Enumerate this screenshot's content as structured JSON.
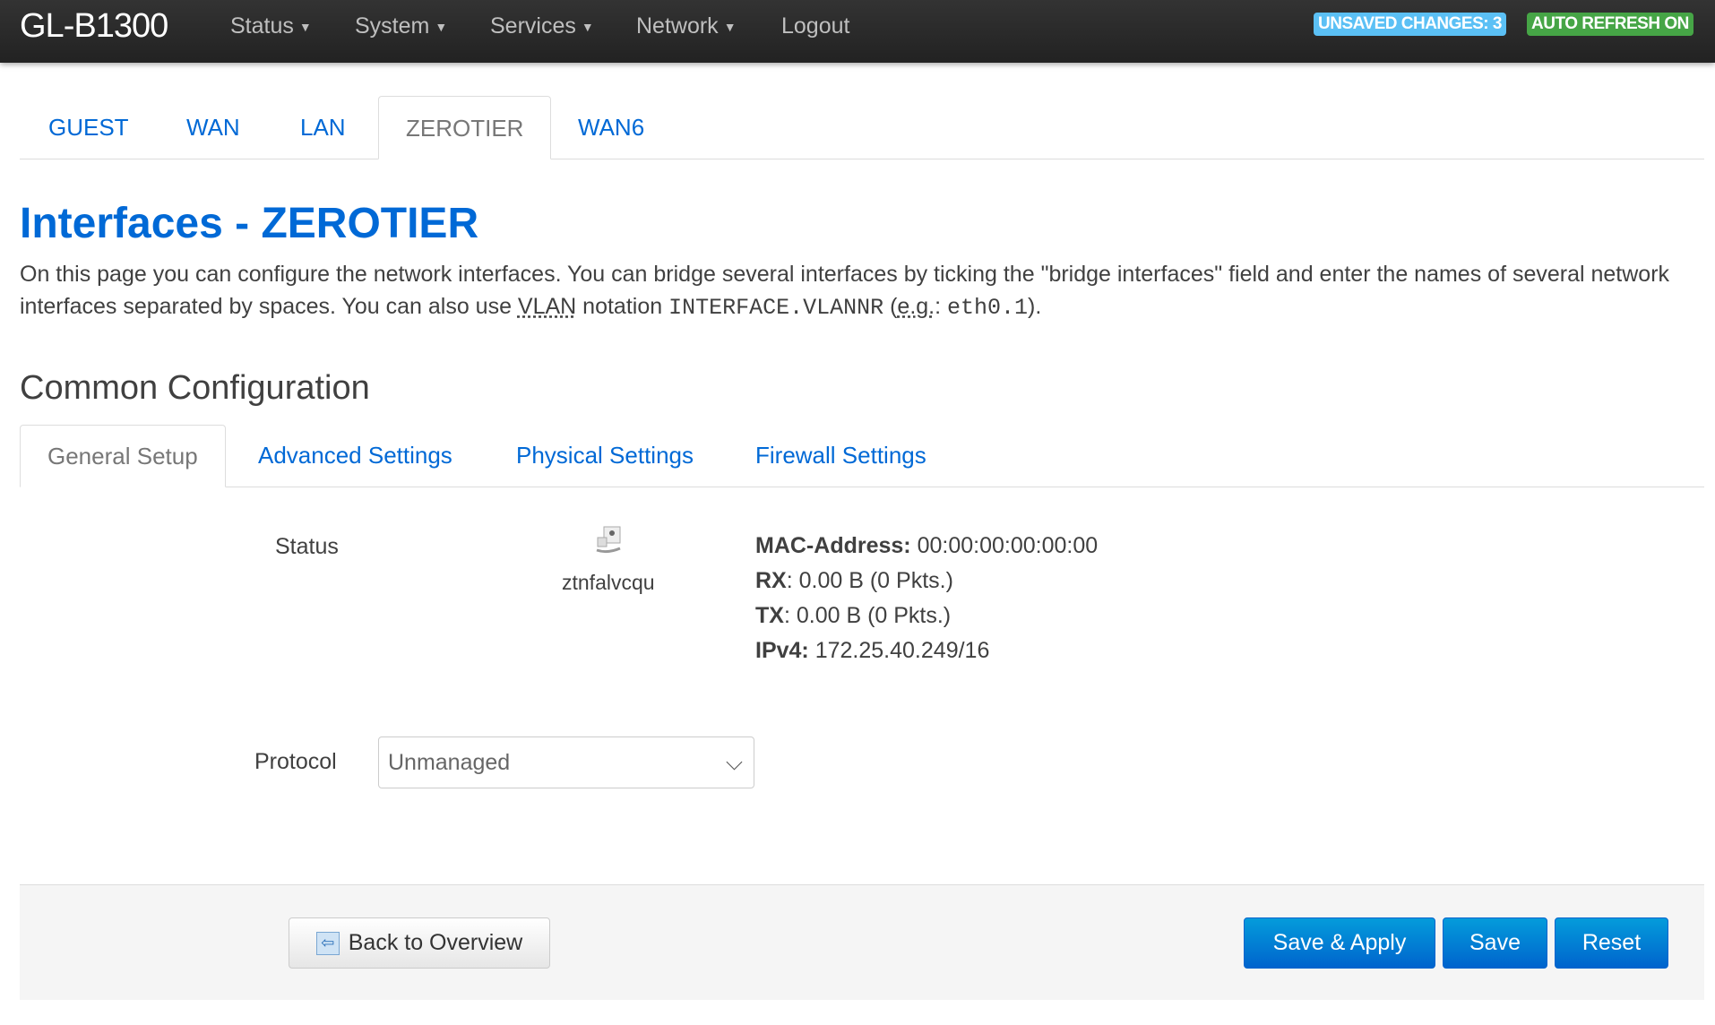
{
  "nav": {
    "brand": "GL-B1300",
    "menu": [
      "Status",
      "System",
      "Services",
      "Network"
    ],
    "logout": "Logout",
    "unsaved": "UNSAVED CHANGES: 3",
    "autorefresh": "AUTO REFRESH ON"
  },
  "tabs": [
    "GUEST",
    "WAN",
    "LAN",
    "ZEROTIER",
    "WAN6"
  ],
  "title": "Interfaces - ZEROTIER",
  "desc": {
    "p1": "On this page you can configure the network interfaces. You can bridge several interfaces by ticking the \"bridge interfaces\" field and enter the names of several network interfaces separated by spaces. You can also use ",
    "vlan": "VLAN",
    "p2": " notation ",
    "code1": "INTERFACE.VLANNR",
    "p3": " (",
    "eg": "e.g.",
    "p4": ": ",
    "code2": "eth0.1",
    "p5": ")."
  },
  "section": "Common Configuration",
  "subtabs": [
    "General Setup",
    "Advanced Settings",
    "Physical Settings",
    "Firewall Settings"
  ],
  "status": {
    "label": "Status",
    "ifname": "ztnfalvcqu",
    "mac_label": "MAC-Address:",
    "mac": "00:00:00:00:00:00",
    "rx_label": "RX",
    "rx": ": 0.00 B (0 Pkts.)",
    "tx_label": "TX",
    "tx": ": 0.00 B (0 Pkts.)",
    "ipv4_label": "IPv4:",
    "ipv4": "172.25.40.249/16"
  },
  "protocol": {
    "label": "Protocol",
    "value": "Unmanaged"
  },
  "footer": {
    "back": "Back to Overview",
    "save_apply": "Save & Apply",
    "save": "Save",
    "reset": "Reset"
  },
  "colors": {
    "link": "#0069d6",
    "unsaved": "#5bc0f5",
    "autorefresh": "#46a546"
  }
}
